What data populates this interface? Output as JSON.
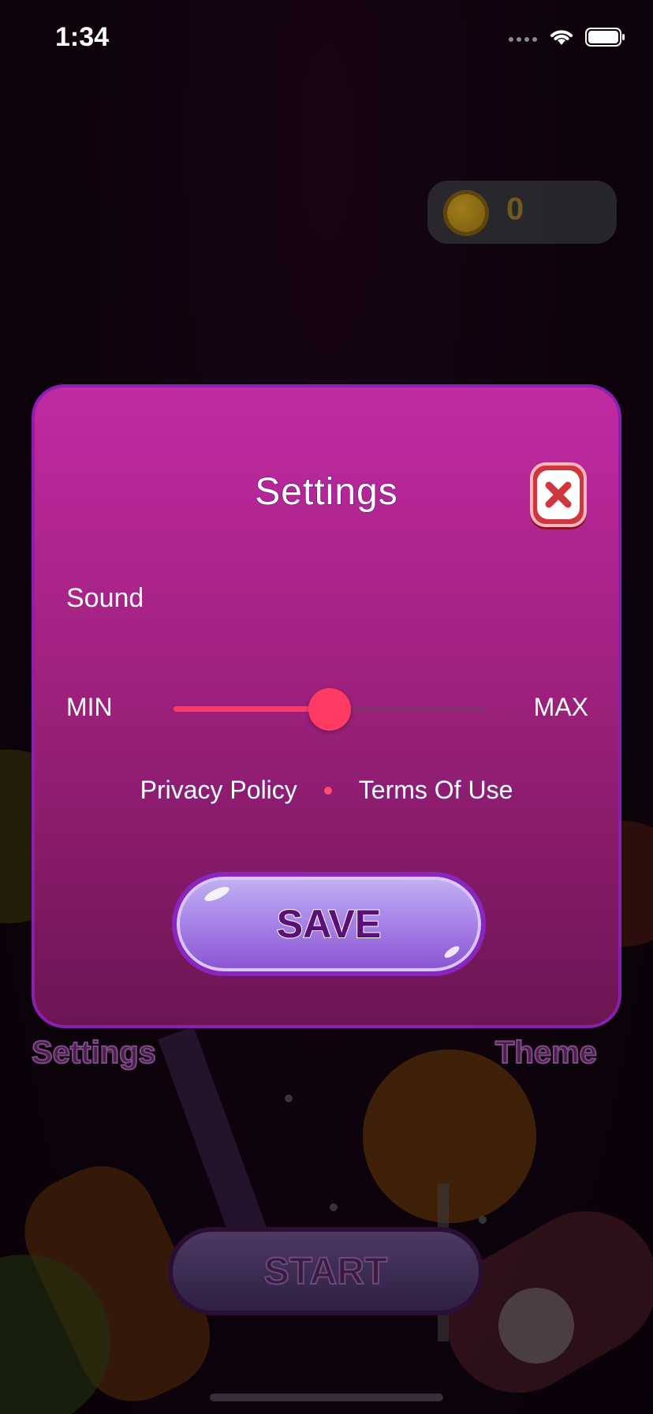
{
  "status_bar": {
    "time": "1:34"
  },
  "coins": {
    "value": "0"
  },
  "background_menu": {
    "settings_label": "Settings",
    "theme_label": "Theme",
    "start_label": "START"
  },
  "dialog": {
    "title": "Settings",
    "sound_label": "Sound",
    "min_label": "MIN",
    "max_label": "MAX",
    "sound_level": 0.5,
    "privacy_link": "Privacy Policy",
    "terms_link": "Terms Of Use",
    "save_label": "SAVE"
  },
  "colors": {
    "dialog_top": "#c02aa2",
    "dialog_bottom": "#6c1554",
    "slider_accent": "#ff3b64",
    "save_button": "#a986e8"
  }
}
